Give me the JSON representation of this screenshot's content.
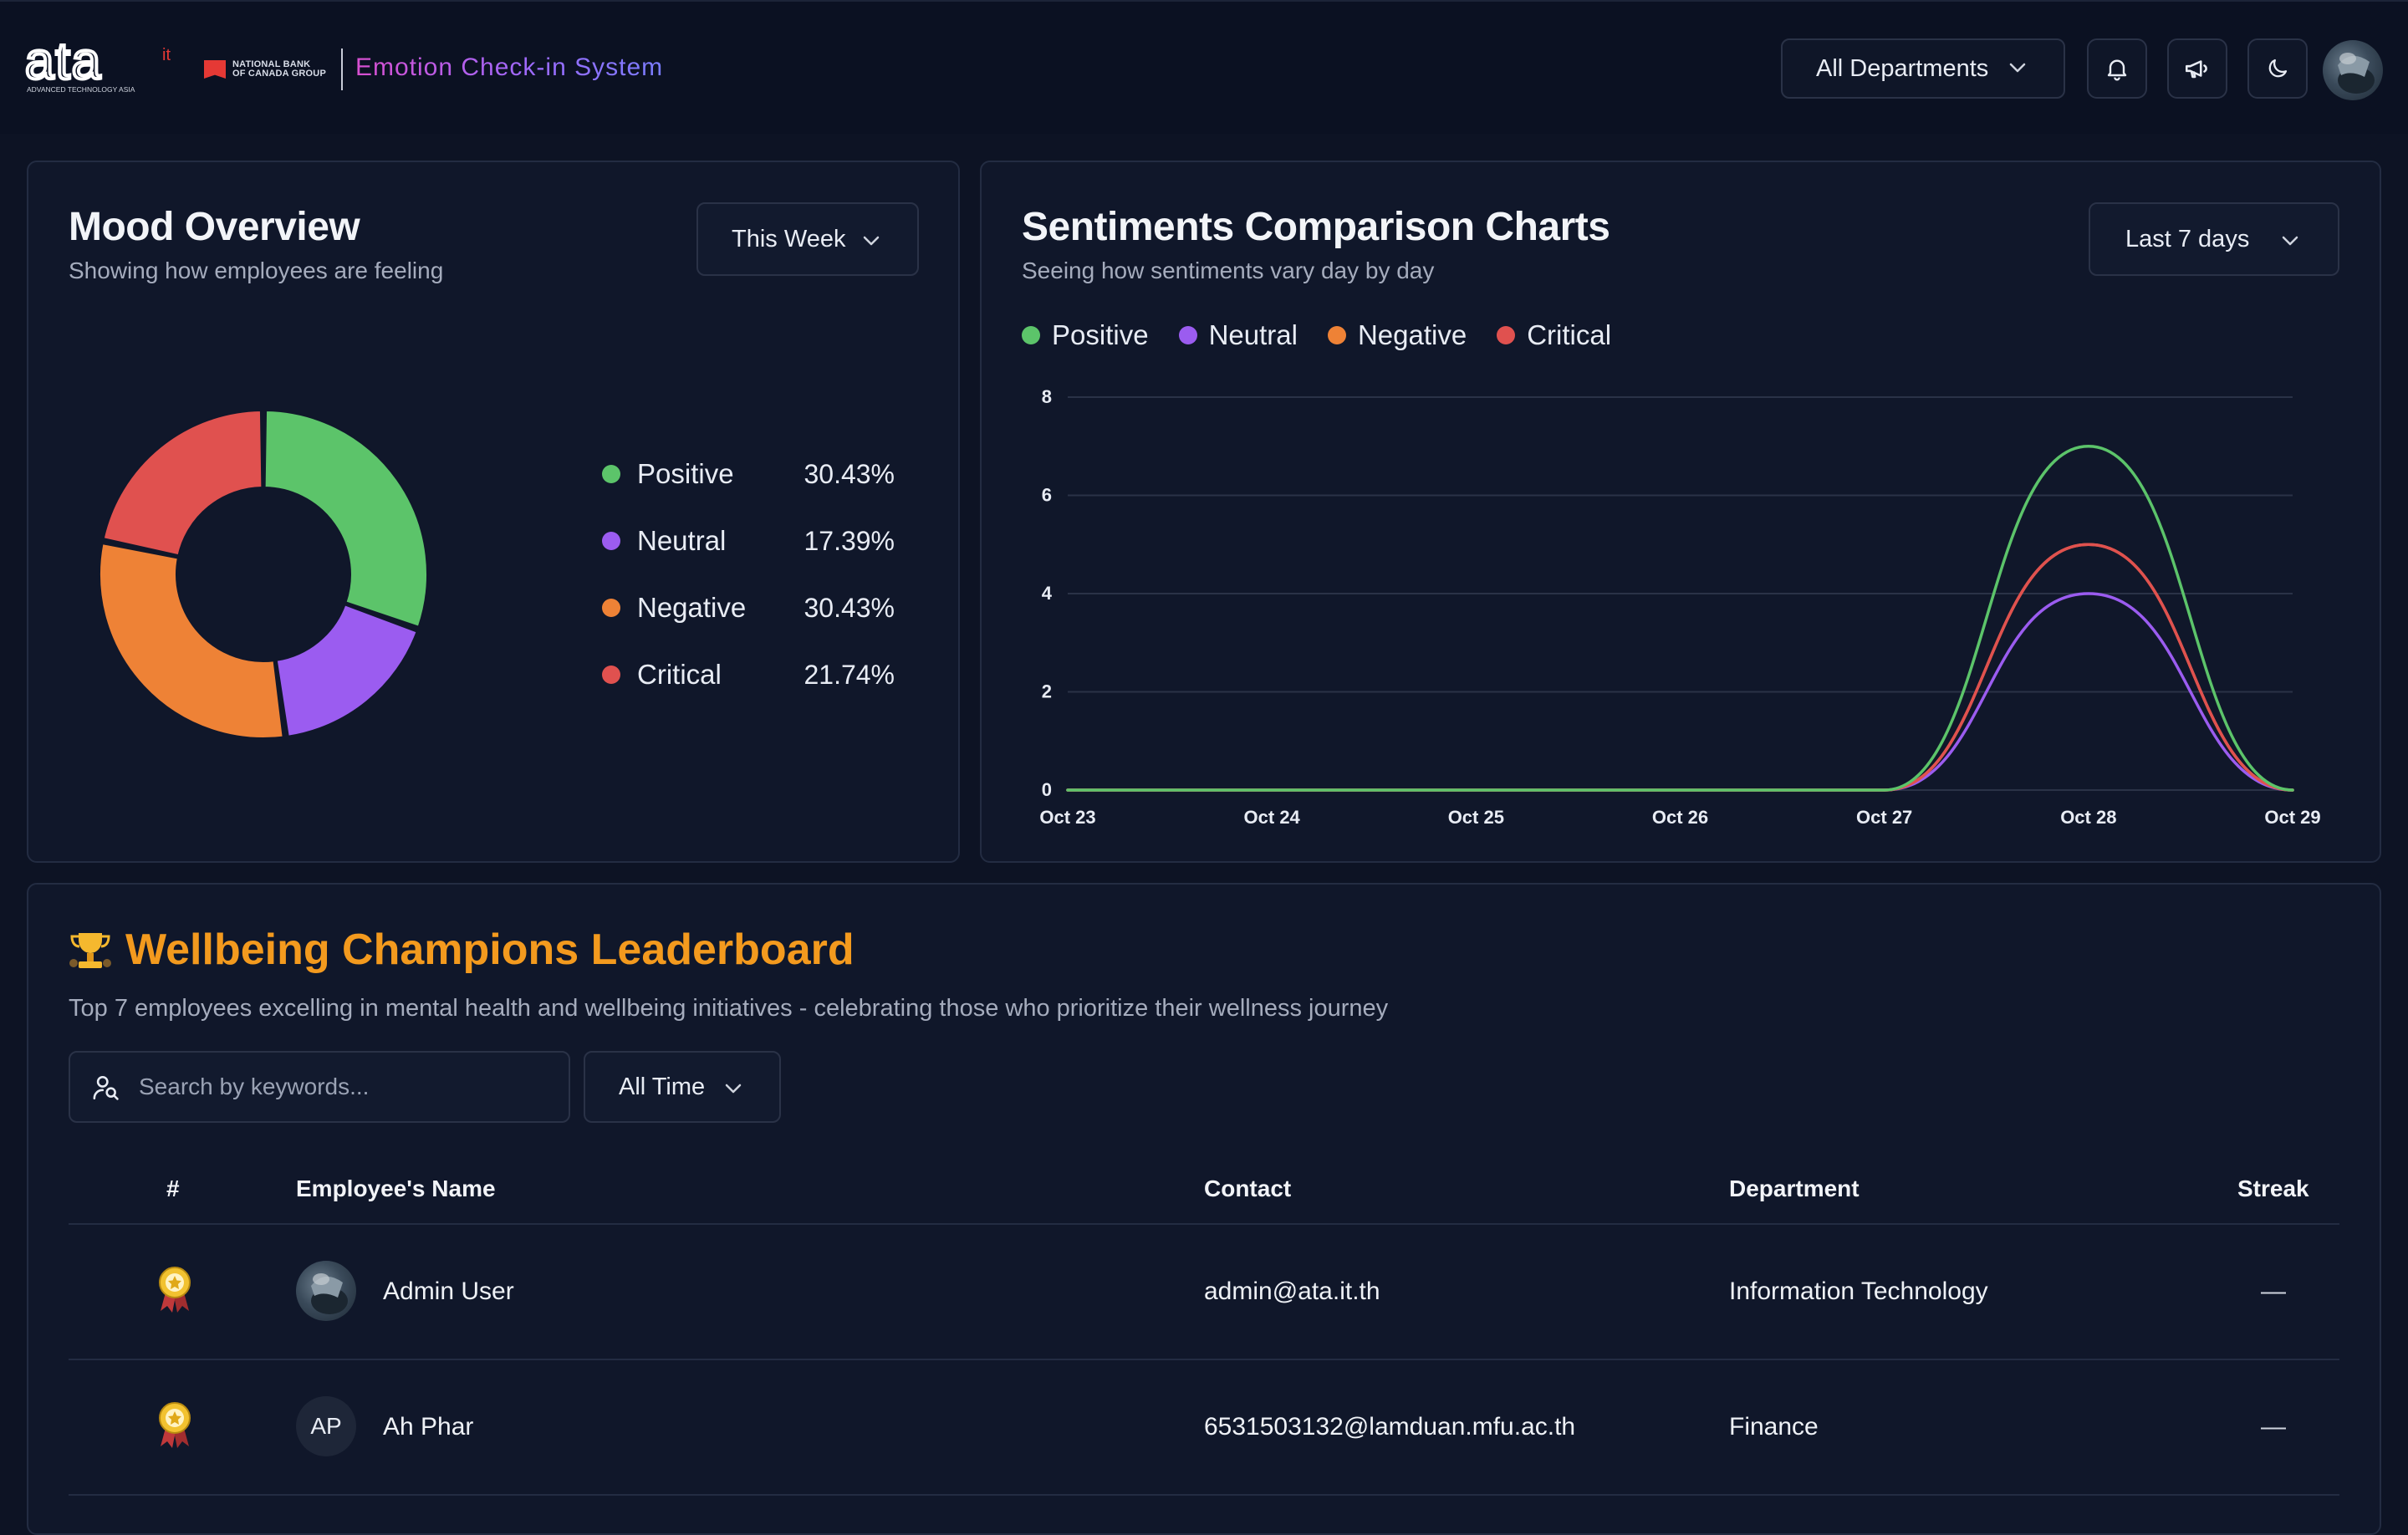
{
  "header": {
    "logo_brand": "ata",
    "logo_brand_sup": "it",
    "logo_tagline": "ADVANCED TECHNOLOGY ASIA",
    "partner_line1": "NATIONAL BANK",
    "partner_line2": "OF CANADA GROUP",
    "app_title": "Emotion Check-in System",
    "department_select": "All Departments",
    "icons": [
      "bell-icon",
      "megaphone-icon",
      "moon-icon"
    ]
  },
  "mood_overview": {
    "title": "Mood Overview",
    "subtitle": "Showing how employees are feeling",
    "period_select": "This Week",
    "legend": [
      {
        "label": "Positive",
        "value": "30.43%",
        "color": "#5cc46a"
      },
      {
        "label": "Neutral",
        "value": "17.39%",
        "color": "#9b5cf0"
      },
      {
        "label": "Negative",
        "value": "30.43%",
        "color": "#ee8236"
      },
      {
        "label": "Critical",
        "value": "21.74%",
        "color": "#e0514f"
      }
    ]
  },
  "sentiments": {
    "title": "Sentiments Comparison Charts",
    "subtitle": "Seeing how sentiments vary day by day",
    "range_select": "Last 7 days",
    "legend": [
      {
        "label": "Positive",
        "color": "#5cc46a"
      },
      {
        "label": "Neutral",
        "color": "#9b5cf0"
      },
      {
        "label": "Negative",
        "color": "#ee8236"
      },
      {
        "label": "Critical",
        "color": "#e0514f"
      }
    ]
  },
  "chart_data": [
    {
      "type": "pie",
      "categories": [
        "Positive",
        "Neutral",
        "Negative",
        "Critical"
      ],
      "values": [
        30.43,
        17.39,
        30.43,
        21.74
      ],
      "colors": [
        "#5cc46a",
        "#9b5cf0",
        "#ee8236",
        "#e0514f"
      ],
      "donut": true
    },
    {
      "type": "line",
      "x": [
        "Oct 23",
        "Oct 24",
        "Oct 25",
        "Oct 26",
        "Oct 27",
        "Oct 28",
        "Oct 29"
      ],
      "yticks": [
        "0",
        "2",
        "4",
        "6",
        "8"
      ],
      "ylim": [
        0,
        8
      ],
      "grid": true,
      "series": [
        {
          "name": "Positive",
          "color": "#5cc46a",
          "values": [
            0,
            0,
            0,
            0,
            0,
            7,
            0
          ]
        },
        {
          "name": "Neutral",
          "color": "#9b5cf0",
          "values": [
            0,
            0,
            0,
            0,
            0,
            4,
            0
          ]
        },
        {
          "name": "Negative",
          "color": "#ee8236",
          "values": [
            0,
            0,
            0,
            0,
            0,
            5,
            0
          ]
        },
        {
          "name": "Critical",
          "color": "#e0514f",
          "values": [
            0,
            0,
            0,
            0,
            0,
            5,
            0
          ]
        }
      ]
    }
  ],
  "leaderboard": {
    "title": "Wellbeing Champions Leaderboard",
    "subtitle": "Top 7 employees excelling in mental health and wellbeing initiatives - celebrating those who prioritize their wellness journey",
    "search_placeholder": "Search by keywords...",
    "time_select": "All Time",
    "columns": [
      "#",
      "Employee's Name",
      "Contact",
      "Department",
      "Streak"
    ],
    "rows": [
      {
        "name": "Admin User",
        "initials": "",
        "contact": "admin@ata.it.th",
        "department": "Information Technology",
        "streak": "—"
      },
      {
        "name": "Ah Phar",
        "initials": "AP",
        "contact": "6531503132@lamduan.mfu.ac.th",
        "department": "Finance",
        "streak": "—"
      }
    ]
  }
}
